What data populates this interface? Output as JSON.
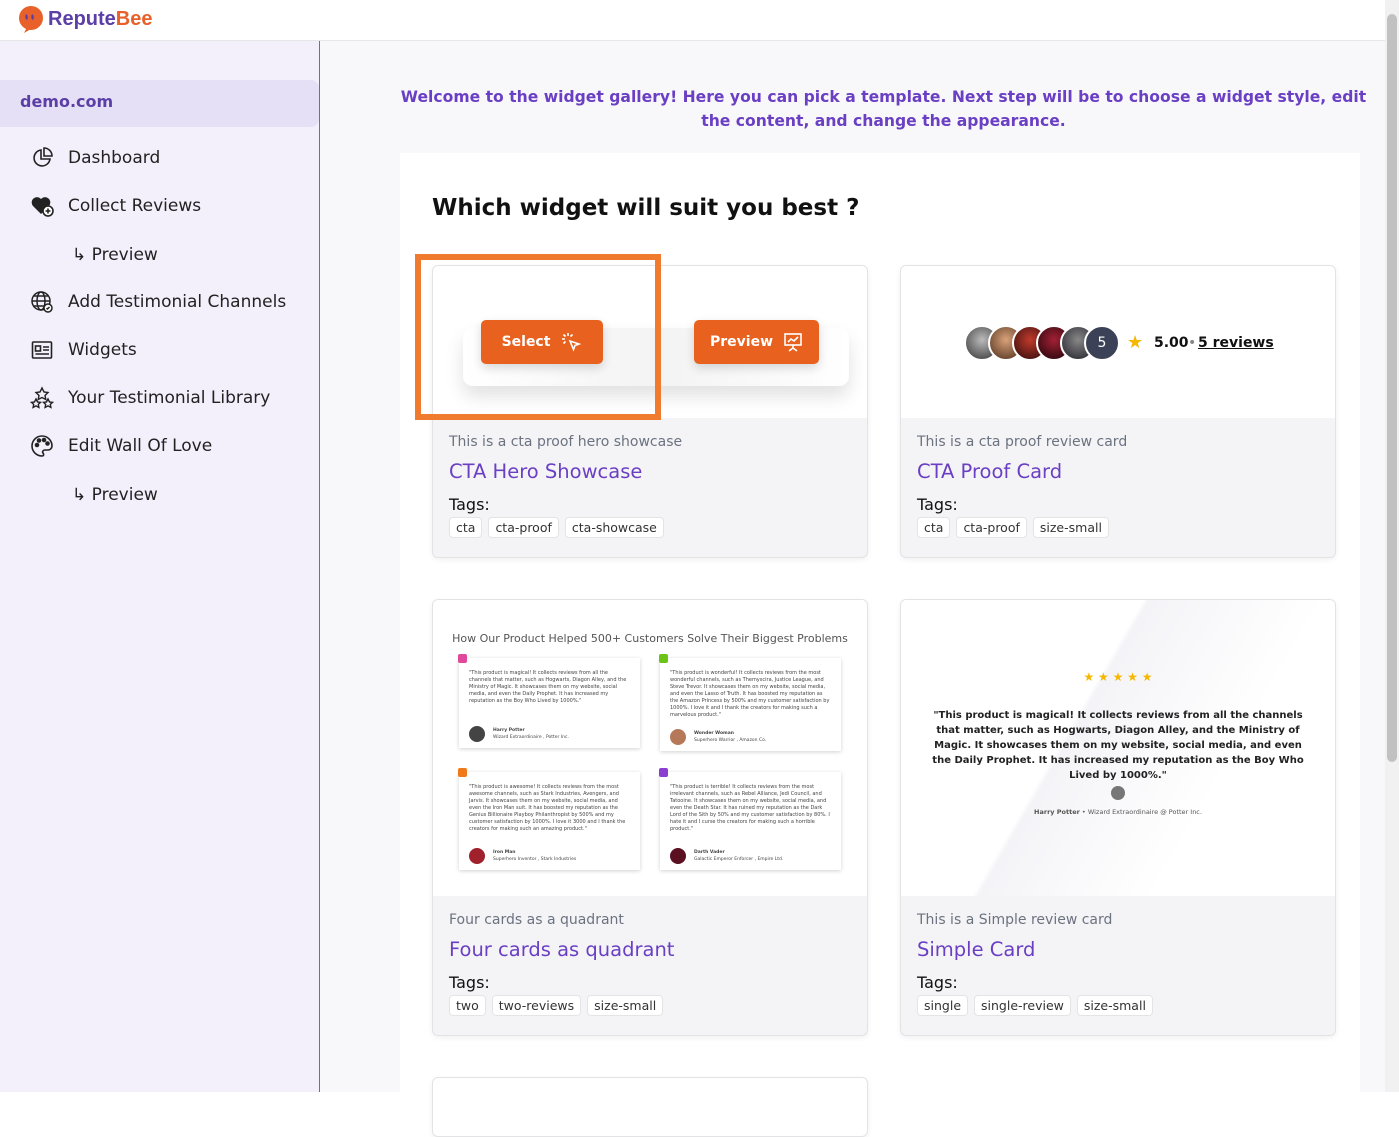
{
  "brand": {
    "name_part1": "Repute",
    "name_part2": "Bee"
  },
  "sidebar": {
    "site": "demo.com",
    "items": [
      {
        "label": "Dashboard"
      },
      {
        "label": "Collect Reviews"
      },
      {
        "label": "↳ Preview"
      },
      {
        "label": "Add Testimonial Channels"
      },
      {
        "label": "Widgets"
      },
      {
        "label": "Your Testimonial Library"
      },
      {
        "label": "Edit Wall Of Love"
      },
      {
        "label": "↳ Preview"
      }
    ]
  },
  "main": {
    "welcome": "Welcome to the widget gallery! Here you can pick a template. Next step will be to choose a widget style, edit the content, and change the appearance.",
    "heading": "Which widget will suit you best ?",
    "tags_label": "Tags:",
    "select_label": "Select",
    "preview_label": "Preview",
    "cards": [
      {
        "desc": "This is a cta proof hero showcase",
        "title": "CTA Hero Showcase",
        "tags": [
          "cta",
          "cta-proof",
          "cta-showcase"
        ]
      },
      {
        "desc": "This is a cta proof review card",
        "title": "CTA Proof Card",
        "tags": [
          "cta",
          "cta-proof",
          "size-small"
        ]
      },
      {
        "desc": "Four cards as a quadrant",
        "title": "Four cards as quadrant",
        "tags": [
          "two",
          "two-reviews",
          "size-small"
        ]
      },
      {
        "desc": "This is a Simple review card",
        "title": "Simple Card",
        "tags": [
          "single",
          "single-review",
          "size-small"
        ]
      }
    ]
  },
  "proof_card": {
    "count_badge": "5",
    "rating": "5.00",
    "separator": "•",
    "reviews_link": "5 reviews"
  },
  "quadrant": {
    "heading": "How Our Product Helped 500+ Customers Solve Their Biggest Problems",
    "reviews": [
      {
        "text": "\"This product is magical! It collects reviews from all the channels that matter, such as Hogwarts, Diagon Alley, and the Ministry of Magic. It showcases them on my website, social media, and even the Daily Prophet. It has increased my reputation as the Boy Who Lived by 1000%.\"",
        "name": "Harry Potter",
        "role": "Wizard Extraordinaire , Potter Inc.",
        "color": "#e0489c"
      },
      {
        "text": "\"This product is wonderful! It collects reviews from the most wonderful channels, such as Themyscira, Justice League, and Steve Trevor. It showcases them on my website, social media, and even the Lasso of Truth. It has boosted my reputation as the Amazon Princess by 500% and my customer satisfaction by 1000%. I love it and I thank the creators for making such a marvelous product.\"",
        "name": "Wonder Woman",
        "role": "Superhero Warrior , Amazon Co.",
        "color": "#6cc417"
      },
      {
        "text": "\"This product is awesome! It collects reviews from the most awesome channels, such as Stark Industries, Avengers, and Jarvis. It showcases them on my website, social media, and even the Iron Man suit. It has boosted my reputation as the Genius Billionaire Playboy Philanthropist by 500% and my customer satisfaction by 1000%. I love it 3000 and I thank the creators for making such an amazing product.\"",
        "name": "Iron Man",
        "role": "Superhero Inventor , Stark Industries",
        "color": "#f07a1a"
      },
      {
        "text": "\"This product is terrible! It collects reviews from the most irrelevant channels, such as Rebel Alliance, Jedi Council, and Tatooine. It showcases them on my website, social media, and even the Death Star. It has ruined my reputation as the Dark Lord of the Sith by 50% and my customer satisfaction by 80%. I hate it and I curse the creators for making such a horrible product.\"",
        "name": "Darth Vader",
        "role": "Galactic Emperor Enforcer , Empire Ltd.",
        "color": "#8a3fd0"
      }
    ]
  },
  "simple_card": {
    "stars": "★ ★ ★ ★ ★",
    "quote": "\"This product is magical! It collects reviews from all the channels that matter, such as Hogwarts, Diagon Alley, and the Ministry of Magic. It showcases them on my website, social media, and even the Daily Prophet. It has increased my reputation as the Boy Who Lived by 1000%.\"",
    "name": "Harry Potter",
    "separator": "•",
    "role": "Wizard Extraordinaire @ Potter Inc."
  },
  "colors": {
    "brand_purple": "#6a3fc4",
    "brand_orange": "#e8611e",
    "highlight": "#f07a2e",
    "sidebar_bg": "#f3f0fb"
  }
}
